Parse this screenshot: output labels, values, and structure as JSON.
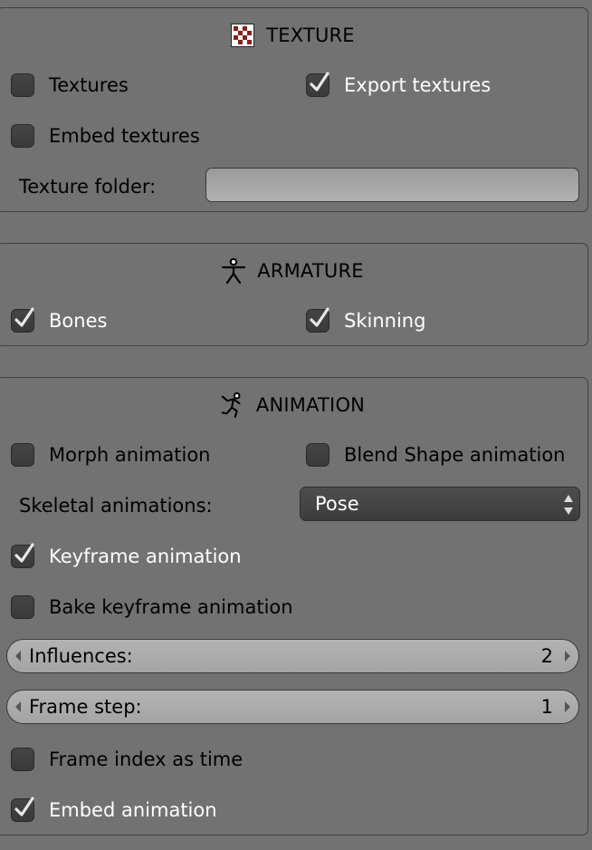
{
  "texture": {
    "title": "TEXTURE",
    "icon": "checker-texture-icon",
    "textures_label": "Textures",
    "textures_checked": false,
    "export_textures_label": "Export textures",
    "export_textures_checked": true,
    "embed_textures_label": "Embed textures",
    "embed_textures_checked": false,
    "texture_folder_label": "Texture folder:",
    "texture_folder_value": ""
  },
  "armature": {
    "title": "ARMATURE",
    "icon": "armature-figure-icon",
    "bones_label": "Bones",
    "bones_checked": true,
    "skinning_label": "Skinning",
    "skinning_checked": true
  },
  "animation": {
    "title": "ANIMATION",
    "icon": "running-figure-icon",
    "morph_label": "Morph animation",
    "morph_checked": false,
    "blend_shape_label": "Blend Shape animation",
    "blend_shape_checked": false,
    "skeletal_label": "Skeletal animations:",
    "skeletal_value": "Pose",
    "keyframe_label": "Keyframe animation",
    "keyframe_checked": true,
    "bake_keyframe_label": "Bake keyframe animation",
    "bake_keyframe_checked": false,
    "influences_label": "Influences:",
    "influences_value": "2",
    "frame_step_label": "Frame step:",
    "frame_step_value": "1",
    "frame_index_label": "Frame index as time",
    "frame_index_checked": false,
    "embed_animation_label": "Embed animation",
    "embed_animation_checked": true
  },
  "colors": {
    "background": "#727272",
    "checkbox": "#3f3f3f",
    "field": "#a8a8a8",
    "select": "#454545"
  }
}
